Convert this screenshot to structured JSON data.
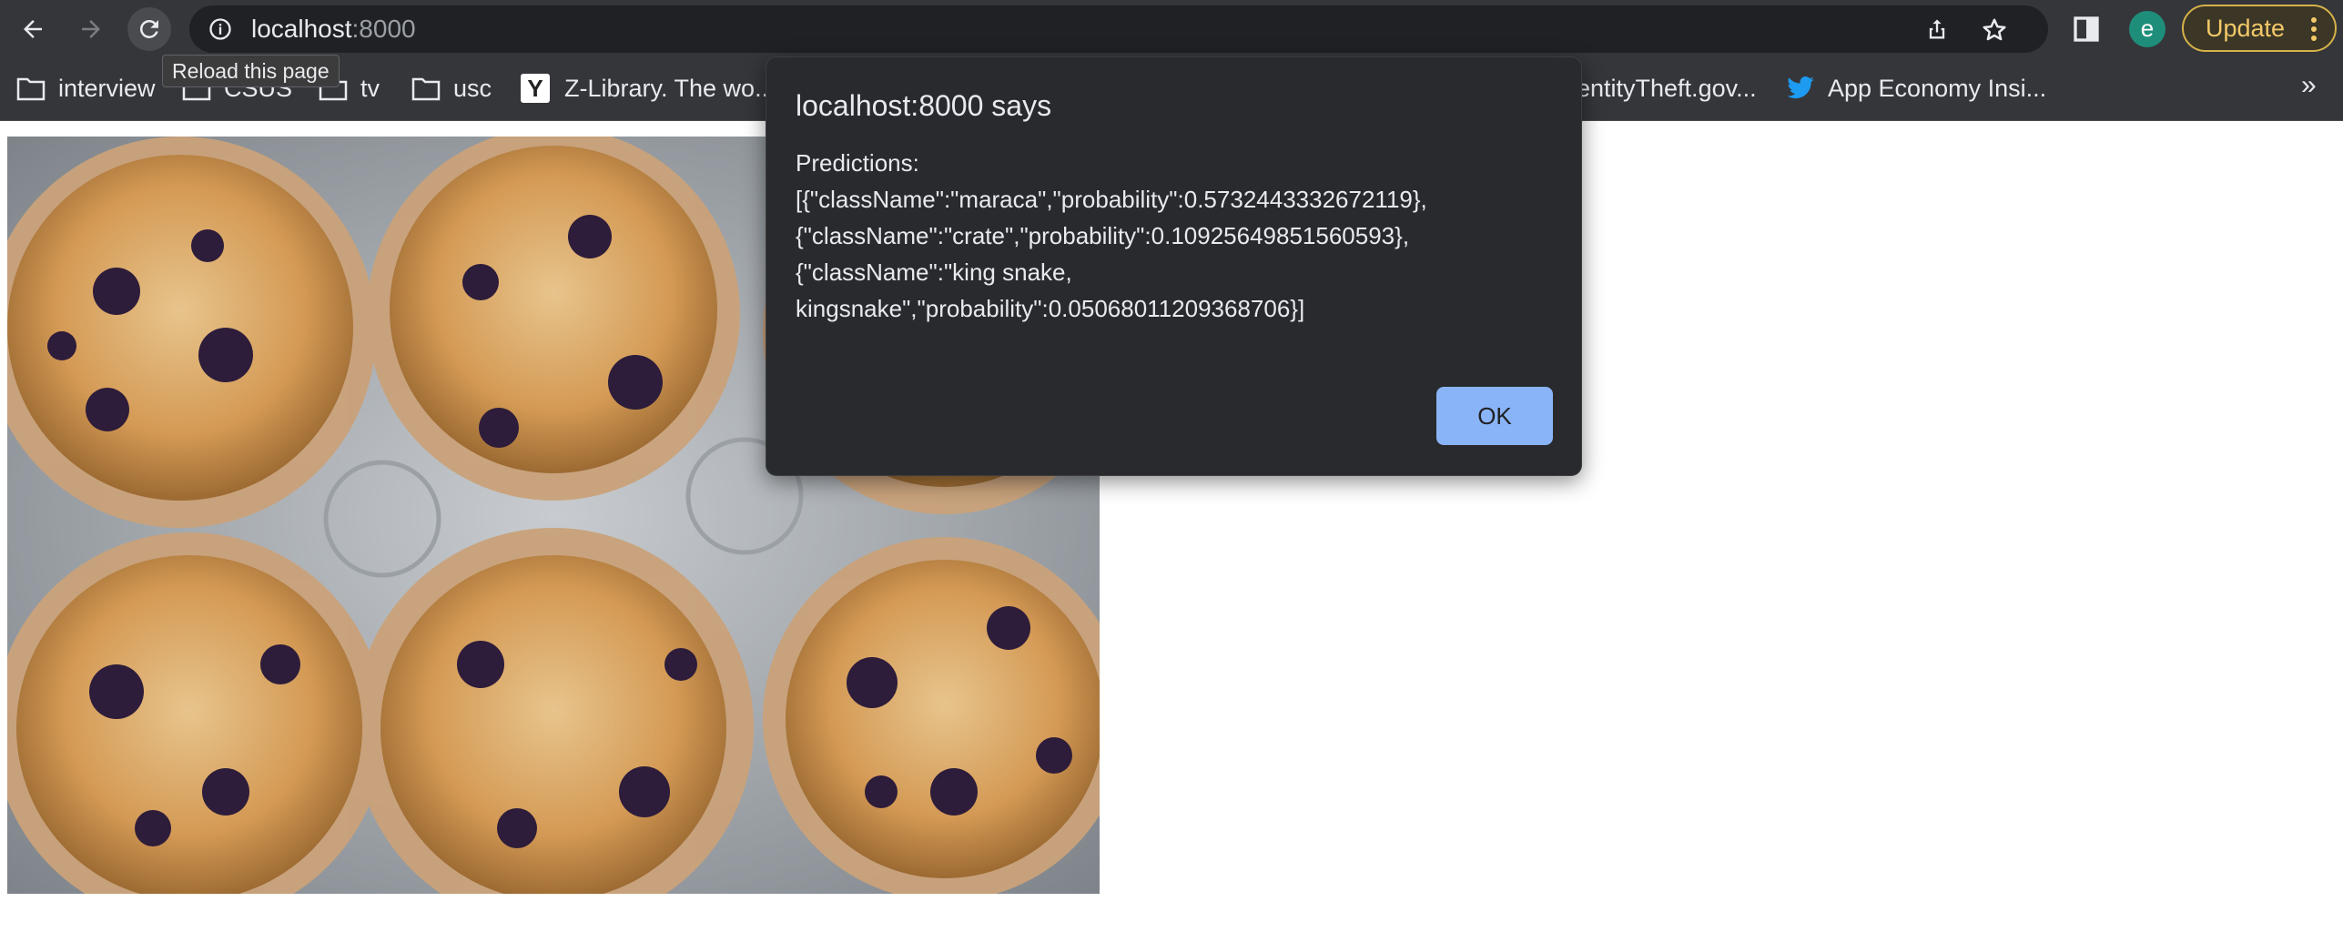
{
  "browser": {
    "url_host": "localhost",
    "url_port": ":8000",
    "reload_tooltip": "Reload this page",
    "profile_initial": "e",
    "update_label": "Update"
  },
  "bookmarks": {
    "items": [
      {
        "label": "interview",
        "icon": "folder-icon"
      },
      {
        "label": "CSUS",
        "icon": "folder-icon"
      },
      {
        "label": "tv",
        "icon": "folder-icon"
      },
      {
        "label": "usc",
        "icon": "folder-icon"
      },
      {
        "label": "Z-Library. The wo...",
        "icon": "z-library-icon"
      },
      {
        "label": "entityTheft.gov...",
        "icon": "identitytheft-icon"
      },
      {
        "label": "App Economy Insi...",
        "icon": "twitter-icon"
      }
    ],
    "overflow": "»"
  },
  "dialog": {
    "title": "localhost:8000 says",
    "message": "Predictions:\n[{\"className\":\"maraca\",\"probability\":0.5732443332672119},\n{\"className\":\"crate\",\"probability\":0.10925649851560593},\n{\"className\":\"king snake,\nkingsnake\",\"probability\":0.05068011209368706}]",
    "ok_label": "OK"
  },
  "colors": {
    "toolbar_bg": "#35363a",
    "omnibox_bg": "#202124",
    "dialog_bg": "#292a2d",
    "ok_button": "#8ab4f8",
    "update_accent": "#f3c969"
  }
}
